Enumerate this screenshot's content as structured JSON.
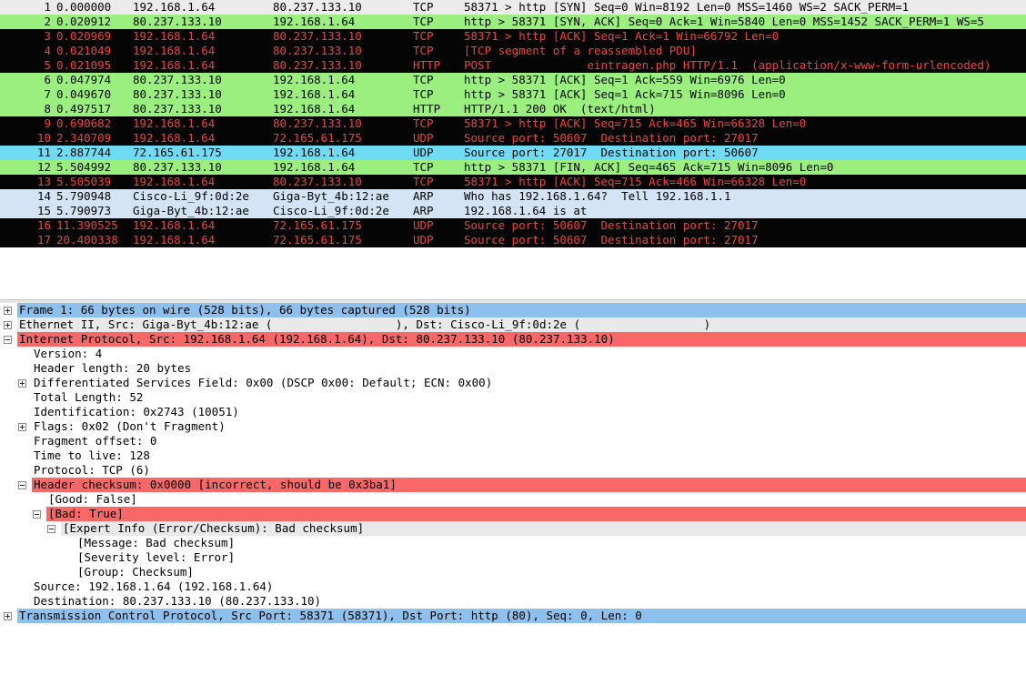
{
  "colors": {
    "tcp_green": "#9bef7e",
    "black_row": "#050505",
    "red_text": "#f24040",
    "udp_blue": "#70dcf3",
    "arp_blue": "#d4e4f4",
    "selected_blue": "#8dc0ec",
    "header_gray": "#e9e9e9",
    "error_red": "#f96767"
  },
  "packets": [
    {
      "no": "1",
      "time": "0.000000",
      "src": "192.168.1.64",
      "dst": "80.237.133.10",
      "proto": "TCP",
      "info": "58371 > http [SYN] Seq=0 Win=8192 Len=0 MSS=1460 WS=2 SACK_PERM=1",
      "style": "gray"
    },
    {
      "no": "2",
      "time": "0.020912",
      "src": "80.237.133.10",
      "dst": "192.168.1.64",
      "proto": "TCP",
      "info": "http > 58371 [SYN, ACK] Seq=0 Ack=1 Win=5840 Len=0 MSS=1452 SACK_PERM=1 WS=5",
      "style": "green"
    },
    {
      "no": "3",
      "time": "0.020969",
      "src": "192.168.1.64",
      "dst": "80.237.133.10",
      "proto": "TCP",
      "info": "58371 > http [ACK] Seq=1 Ack=1 Win=66792 Len=0",
      "style": "black"
    },
    {
      "no": "4",
      "time": "0.021049",
      "src": "192.168.1.64",
      "dst": "80.237.133.10",
      "proto": "TCP",
      "info": "[TCP segment of a reassembled PDU]",
      "style": "black"
    },
    {
      "no": "5",
      "time": "0.021095",
      "src": "192.168.1.64",
      "dst": "80.237.133.10",
      "proto": "HTTP",
      "info": "POST              eintragen.php HTTP/1.1  (application/x-www-form-urlencoded)",
      "style": "black"
    },
    {
      "no": "6",
      "time": "0.047974",
      "src": "80.237.133.10",
      "dst": "192.168.1.64",
      "proto": "TCP",
      "info": "http > 58371 [ACK] Seq=1 Ack=559 Win=6976 Len=0",
      "style": "green"
    },
    {
      "no": "7",
      "time": "0.049670",
      "src": "80.237.133.10",
      "dst": "192.168.1.64",
      "proto": "TCP",
      "info": "http > 58371 [ACK] Seq=1 Ack=715 Win=8096 Len=0",
      "style": "green"
    },
    {
      "no": "8",
      "time": "0.497517",
      "src": "80.237.133.10",
      "dst": "192.168.1.64",
      "proto": "HTTP",
      "info": "HTTP/1.1 200 OK  (text/html)",
      "style": "green"
    },
    {
      "no": "9",
      "time": "0.690682",
      "src": "192.168.1.64",
      "dst": "80.237.133.10",
      "proto": "TCP",
      "info": "58371 > http [ACK] Seq=715 Ack=465 Win=66328 Len=0",
      "style": "black"
    },
    {
      "no": "10",
      "time": "2.340709",
      "src": "192.168.1.64",
      "dst": "72.165.61.175",
      "proto": "UDP",
      "info": "Source port: 50607  Destination port: 27017",
      "style": "black"
    },
    {
      "no": "11",
      "time": "2.887744",
      "src": "72.165.61.175",
      "dst": "192.168.1.64",
      "proto": "UDP",
      "info": "Source port: 27017  Destination port: 50607",
      "style": "cyan"
    },
    {
      "no": "12",
      "time": "5.504992",
      "src": "80.237.133.10",
      "dst": "192.168.1.64",
      "proto": "TCP",
      "info": "http > 58371 [FIN, ACK] Seq=465 Ack=715 Win=8096 Len=0",
      "style": "green"
    },
    {
      "no": "13",
      "time": "5.505039",
      "src": "192.168.1.64",
      "dst": "80.237.133.10",
      "proto": "TCP",
      "info": "58371 > http [ACK] Seq=715 Ack=466 Win=66328 Len=0",
      "style": "black"
    },
    {
      "no": "14",
      "time": "5.790948",
      "src": "Cisco-Li_9f:0d:2e",
      "dst": "Giga-Byt_4b:12:ae",
      "proto": "ARP",
      "info": "Who has 192.168.1.64?  Tell 192.168.1.1",
      "style": "arp"
    },
    {
      "no": "15",
      "time": "5.790973",
      "src": "Giga-Byt_4b:12:ae",
      "dst": "Cisco-Li_9f:0d:2e",
      "proto": "ARP",
      "info": "192.168.1.64 is at",
      "style": "arp"
    },
    {
      "no": "16",
      "time": "11.390525",
      "src": "192.168.1.64",
      "dst": "72.165.61.175",
      "proto": "UDP",
      "info": "Source port: 50607  Destination port: 27017",
      "style": "black"
    },
    {
      "no": "17",
      "time": "20.400338",
      "src": "192.168.1.64",
      "dst": "72.165.61.175",
      "proto": "UDP",
      "info": "Source port: 50607  Destination port: 27017",
      "style": "black"
    }
  ],
  "details": [
    {
      "text": "Frame 1: 66 bytes on wire (528 bits), 66 bytes captured (528 bits)",
      "level": 0,
      "toggle": "plus",
      "style": "blue",
      "name": "frame-node"
    },
    {
      "text": "Ethernet II, Src: Giga-Byt_4b:12:ae (                  ), Dst: Cisco-Li_9f:0d:2e (                  )",
      "level": 0,
      "toggle": "plus",
      "style": "gray",
      "name": "ethernet-node"
    },
    {
      "text": "Internet Protocol, Src: 192.168.1.64 (192.168.1.64), Dst: 80.237.133.10 (80.237.133.10)",
      "level": 0,
      "toggle": "minus",
      "style": "red",
      "name": "ip-node"
    },
    {
      "text": "Version: 4",
      "level": 1,
      "toggle": "none",
      "style": "none",
      "name": "ip-version"
    },
    {
      "text": "Header length: 20 bytes",
      "level": 1,
      "toggle": "none",
      "style": "none",
      "name": "ip-header-length"
    },
    {
      "text": "Differentiated Services Field: 0x00 (DSCP 0x00: Default; ECN: 0x00)",
      "level": 1,
      "toggle": "plus",
      "style": "none",
      "name": "ip-dsfield-node"
    },
    {
      "text": "Total Length: 52",
      "level": 1,
      "toggle": "none",
      "style": "none",
      "name": "ip-total-length"
    },
    {
      "text": "Identification: 0x2743 (10051)",
      "level": 1,
      "toggle": "none",
      "style": "none",
      "name": "ip-identification"
    },
    {
      "text": "Flags: 0x02 (Don't Fragment)",
      "level": 1,
      "toggle": "plus",
      "style": "none",
      "name": "ip-flags-node"
    },
    {
      "text": "Fragment offset: 0",
      "level": 1,
      "toggle": "none",
      "style": "none",
      "name": "ip-fragment-offset"
    },
    {
      "text": "Time to live: 128",
      "level": 1,
      "toggle": "none",
      "style": "none",
      "name": "ip-ttl"
    },
    {
      "text": "Protocol: TCP (6)",
      "level": 1,
      "toggle": "none",
      "style": "none",
      "name": "ip-protocol"
    },
    {
      "text": "Header checksum: 0x0000 [incorrect, should be 0x3ba1]",
      "level": 1,
      "toggle": "minus",
      "style": "red",
      "name": "ip-checksum-node"
    },
    {
      "text": "[Good: False]",
      "level": 2,
      "toggle": "none",
      "style": "none",
      "name": "checksum-good"
    },
    {
      "text": "[Bad: True]",
      "level": 2,
      "toggle": "minus",
      "style": "red",
      "name": "checksum-bad-node"
    },
    {
      "text": "[Expert Info (Error/Checksum): Bad checksum]",
      "level": 3,
      "toggle": "minus",
      "style": "gray",
      "name": "expert-info-node"
    },
    {
      "text": "[Message: Bad checksum]",
      "level": 4,
      "toggle": "none",
      "style": "none",
      "name": "expert-message"
    },
    {
      "text": "[Severity level: Error]",
      "level": 4,
      "toggle": "none",
      "style": "none",
      "name": "expert-severity"
    },
    {
      "text": "[Group: Checksum]",
      "level": 4,
      "toggle": "none",
      "style": "none",
      "name": "expert-group"
    },
    {
      "text": "Source: 192.168.1.64 (192.168.1.64)",
      "level": 1,
      "toggle": "none",
      "style": "none",
      "name": "ip-source"
    },
    {
      "text": "Destination: 80.237.133.10 (80.237.133.10)",
      "level": 1,
      "toggle": "none",
      "style": "none",
      "name": "ip-destination"
    },
    {
      "text": "Transmission Control Protocol, Src Port: 58371 (58371), Dst Port: http (80), Seq: 0, Len: 0",
      "level": 0,
      "toggle": "plus",
      "style": "blue",
      "name": "tcp-node"
    }
  ]
}
